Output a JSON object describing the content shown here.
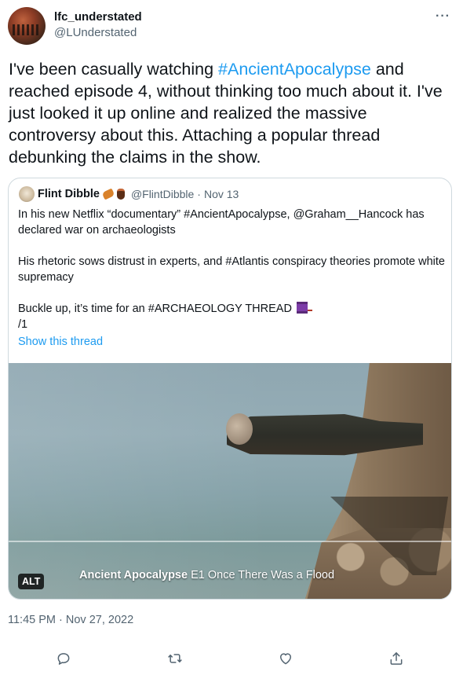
{
  "author": {
    "display_name": "lfc_understated",
    "handle": "@LUnderstated",
    "more_label": "···"
  },
  "tweet": {
    "text_before": "I've been casually watching ",
    "hashtag": "#AncientApocalypse",
    "text_after": " and reached episode 4, without thinking too much about it. I've just looked it up online and realized the massive controversy about this. Attaching a popular thread debunking the claims in the show.",
    "timestamp": "11:45 PM · Nov 27, 2022"
  },
  "quote": {
    "display_name": "Flint Dibble",
    "handle": "@FlintDibble",
    "dot": "·",
    "date": "Nov 13",
    "paragraph1": "In his new Netflix “documentary” #AncientApocalypse, @Graham__Hancock has declared war on archaeologists",
    "paragraph2": "His rhetoric sows distrust in experts, and #Atlantis conspiracy theories promote white supremacy",
    "paragraph3_line1": "Buckle up, it’s time for an #ARCHAEOLOGY THREAD",
    "paragraph3_line2": "/1",
    "show_thread": "Show this thread",
    "media": {
      "alt_badge": "ALT",
      "caption_title": "Ancient Apocalypse",
      "caption_episode": " E1  Once There Was a Flood"
    }
  },
  "actions": [
    {
      "name": "reply-icon"
    },
    {
      "name": "retweet-icon"
    },
    {
      "name": "like-icon"
    },
    {
      "name": "share-icon"
    }
  ],
  "colors": {
    "link": "#1d9bf0",
    "secondary_text": "#536471",
    "border": "#cfd9de"
  }
}
